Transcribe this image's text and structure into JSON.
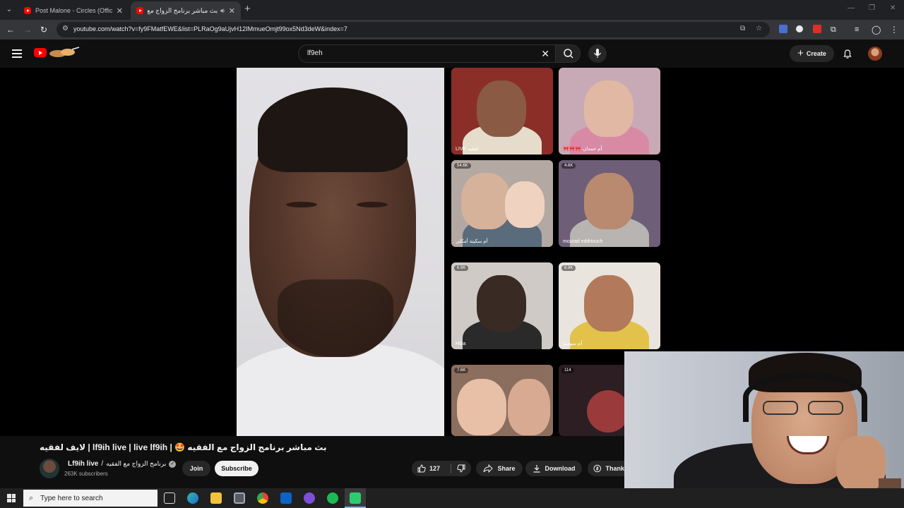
{
  "browser": {
    "tabs": [
      {
        "title": "Post Malone - Circles (Official M",
        "active": false
      },
      {
        "title": "بث مباشر برنامج الزواج مع الف",
        "active": true
      }
    ],
    "url": "youtube.com/watch?v=fy9FMatfEWE&list=PLRaOg9aUjvH12IMmueOmjt99ox5Nd3deW&index=7",
    "icons": [
      "tab-search-icon",
      "back-arrow-icon",
      "forward-arrow-icon",
      "reload-icon",
      "site-info-icon",
      "install-icon",
      "bookmark-star-icon",
      "translate-icon",
      "extensions-icon",
      "media-icon",
      "profile-icon",
      "menu-dots-icon"
    ]
  },
  "masthead": {
    "search_value": "lf9eh",
    "create_label": "Create",
    "logo_color": "#ff0000"
  },
  "video": {
    "title": "لايف لفقيه | lf9ih live | live lf9ih | 🤩 بث مباشر برنامج الزواج مع الفقيه",
    "tiles": [
      {
        "badge": "",
        "name": "LIVE لفقيه"
      },
      {
        "badge": "",
        "name": "🎀🎀🎀 أم حمدان"
      },
      {
        "badge": "54.6K",
        "name": "أم سكينة أمكلي"
      },
      {
        "badge": "4.6K",
        "name": "mourad eddriouch"
      },
      {
        "badge": "6.9K",
        "name": "Hiba"
      },
      {
        "badge": "6.9K",
        "name": "أم سومية"
      },
      {
        "badge": "7.6K",
        "name": ""
      },
      {
        "badge": "114",
        "name": ""
      }
    ]
  },
  "channel": {
    "name": "Lf9ih live",
    "name_ar": "برنامج الزواج مع الفقيه",
    "subscribers": "263K subscribers",
    "join_label": "Join",
    "subscribe_label": "Subscribe"
  },
  "actions": {
    "likes": "127",
    "share_label": "Share",
    "download_label": "Download",
    "thanks_label": "Thank"
  },
  "taskbar": {
    "search_placeholder": "Type here to search",
    "accent": "#76b9ed"
  }
}
